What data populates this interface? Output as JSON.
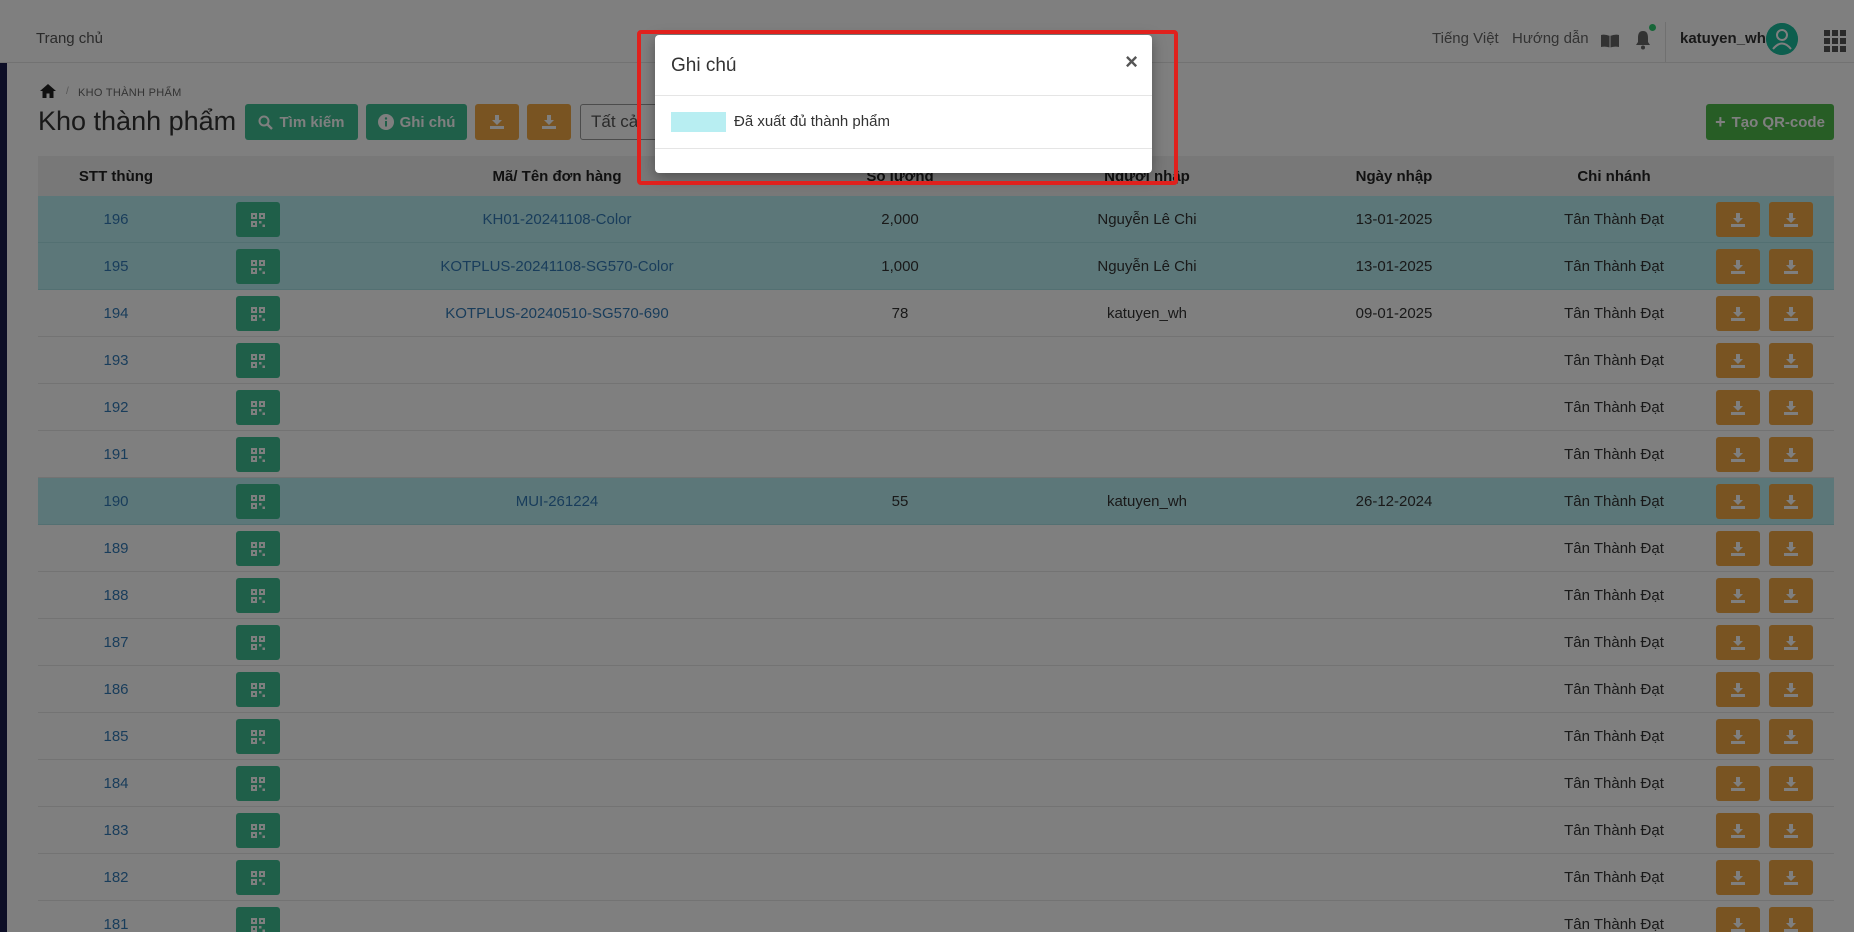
{
  "nav": {
    "home": "Trang chủ",
    "language": "Tiếng Việt",
    "guide": "Hướng dẫn",
    "username": "katuyen_wh"
  },
  "breadcrumb": {
    "section": "KHO THÀNH PHẨM"
  },
  "page": {
    "title": "Kho thành phẩm"
  },
  "toolbar": {
    "search_label": "Tìm kiếm",
    "note_label": "Ghi chú",
    "filter_value": "Tất cả",
    "create_qr_label": "Tạo QR-code"
  },
  "table": {
    "headers": [
      "STT thùng",
      "Mã/ Tên đơn hàng",
      "Số lượng",
      "Người nhập",
      "Ngày nhập",
      "Chi nhánh"
    ],
    "rows": [
      {
        "stt": "196",
        "order": "KH01-20241108-Color",
        "qty": "2,000",
        "user": "Nguyễn Lê Chi",
        "date": "13-01-2025",
        "branch": "Tân Thành Đạt",
        "hl": true
      },
      {
        "stt": "195",
        "order": "KOTPLUS-20241108-SG570-Color",
        "qty": "1,000",
        "user": "Nguyễn Lê Chi",
        "date": "13-01-2025",
        "branch": "Tân Thành Đạt",
        "hl": true
      },
      {
        "stt": "194",
        "order": "KOTPLUS-20240510-SG570-690",
        "qty": "78",
        "user": "katuyen_wh",
        "date": "09-01-2025",
        "branch": "Tân Thành Đạt",
        "hl": false
      },
      {
        "stt": "193",
        "order": "",
        "qty": "",
        "user": "",
        "date": "",
        "branch": "Tân Thành Đạt",
        "hl": false
      },
      {
        "stt": "192",
        "order": "",
        "qty": "",
        "user": "",
        "date": "",
        "branch": "Tân Thành Đạt",
        "hl": false
      },
      {
        "stt": "191",
        "order": "",
        "qty": "",
        "user": "",
        "date": "",
        "branch": "Tân Thành Đạt",
        "hl": false
      },
      {
        "stt": "190",
        "order": "MUI-261224",
        "qty": "55",
        "user": "katuyen_wh",
        "date": "26-12-2024",
        "branch": "Tân Thành Đạt",
        "hl": true
      },
      {
        "stt": "189",
        "order": "",
        "qty": "",
        "user": "",
        "date": "",
        "branch": "Tân Thành Đạt",
        "hl": false
      },
      {
        "stt": "188",
        "order": "",
        "qty": "",
        "user": "",
        "date": "",
        "branch": "Tân Thành Đạt",
        "hl": false
      },
      {
        "stt": "187",
        "order": "",
        "qty": "",
        "user": "",
        "date": "",
        "branch": "Tân Thành Đạt",
        "hl": false
      },
      {
        "stt": "186",
        "order": "",
        "qty": "",
        "user": "",
        "date": "",
        "branch": "Tân Thành Đạt",
        "hl": false
      },
      {
        "stt": "185",
        "order": "",
        "qty": "",
        "user": "",
        "date": "",
        "branch": "Tân Thành Đạt",
        "hl": false
      },
      {
        "stt": "184",
        "order": "",
        "qty": "",
        "user": "",
        "date": "",
        "branch": "Tân Thành Đạt",
        "hl": false
      },
      {
        "stt": "183",
        "order": "",
        "qty": "",
        "user": "",
        "date": "",
        "branch": "Tân Thành Đạt",
        "hl": false
      },
      {
        "stt": "182",
        "order": "",
        "qty": "",
        "user": "",
        "date": "",
        "branch": "Tân Thành Đạt",
        "hl": false
      },
      {
        "stt": "181",
        "order": "",
        "qty": "",
        "user": "",
        "date": "",
        "branch": "Tân Thành Đạt",
        "hl": false
      }
    ]
  },
  "modal": {
    "title": "Ghi chú",
    "close": "×",
    "legend_text": "Đã xuất đủ thành phẩm"
  },
  "colors": {
    "highlight_row": "#b8eef2",
    "primary_green": "#3fbf93",
    "accent_orange": "#f2a945",
    "frame_red": "#e0211d"
  },
  "icons": {
    "home": "home-icon",
    "search": "search-icon",
    "info": "info-icon",
    "download": "download-icon",
    "qr": "qr-code-icon",
    "plus": "plus-icon",
    "bell": "bell-icon",
    "book": "book-icon",
    "apps": "apps-grid-icon"
  }
}
